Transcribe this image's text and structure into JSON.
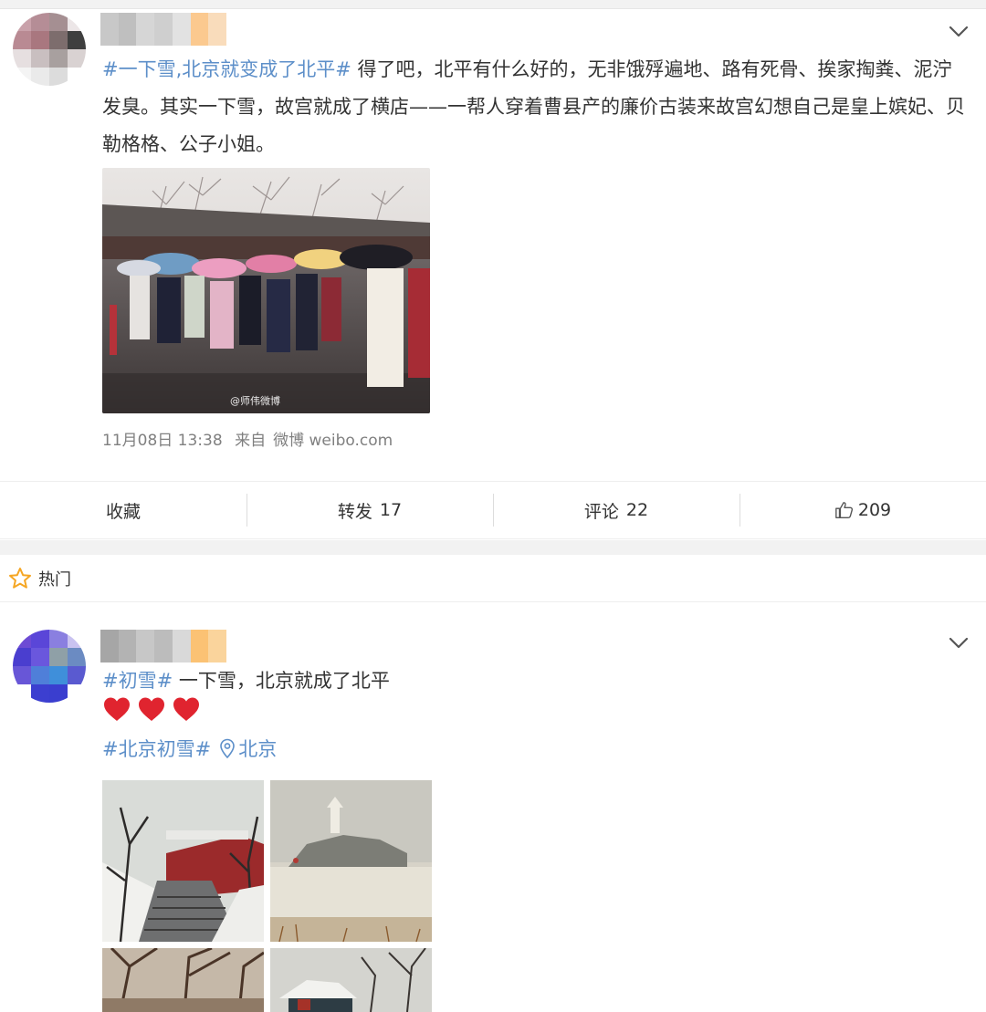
{
  "post1": {
    "hashtag": "#一下雪,北京就变成了北平#",
    "text": " 得了吧，北平有什么好的，无非饿殍遍地、路有死骨、挨家掏粪、泥泞发臭。其实一下雪，故宫就成了横店——一帮人穿着曹县产的廉价古装来故宫幻想自己是皇上嫔妃、贝勒格格、公子小姐。",
    "image_watermark": "@师伟微博",
    "timestamp": "11月08日 13:38",
    "source_prefix": "来自",
    "source_name": "微博 weibo.com",
    "actions": {
      "favorite_label": "收藏",
      "repost_label": "转发",
      "repost_count": "17",
      "comment_label": "评论",
      "comment_count": "22",
      "like_count": "209"
    }
  },
  "hot_section": {
    "label": "热门",
    "icon": "star-outline-icon"
  },
  "post2": {
    "hashtag": "#初雪#",
    "text": " 一下雪，北京就成了北平",
    "hearts": [
      "heart-icon",
      "heart-icon",
      "heart-icon"
    ],
    "hashtag2": "#北京初雪#",
    "location": "北京",
    "location_icon": "location-pin-icon"
  },
  "colors": {
    "link": "#5d8fc9",
    "text": "#333333",
    "meta": "#808080",
    "heart": "#e0242f"
  }
}
